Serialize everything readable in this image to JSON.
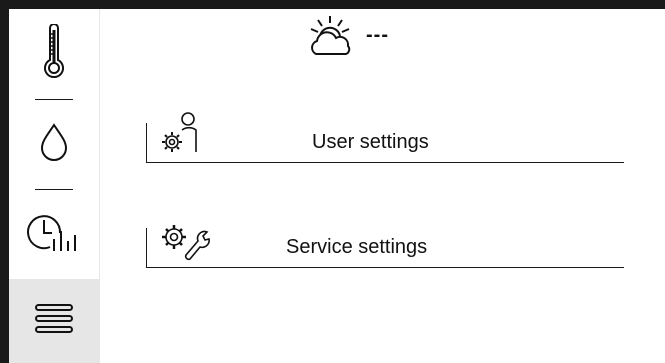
{
  "sidebar": {
    "items": [
      {
        "icon": "thermometer-icon"
      },
      {
        "icon": "water-drop-icon"
      },
      {
        "icon": "clock-chart-icon"
      },
      {
        "icon": "menu-icon",
        "active": true
      }
    ]
  },
  "weather": {
    "icon": "partly-sunny-icon",
    "value": "---"
  },
  "menu": {
    "items": [
      {
        "label": "User settings",
        "icon": "user-settings-icon"
      },
      {
        "label": "Service settings",
        "icon": "service-settings-icon"
      }
    ]
  },
  "colors": {
    "frame": "#1a1a1a",
    "active_background": "#e6e6e6",
    "text": "#111111"
  }
}
